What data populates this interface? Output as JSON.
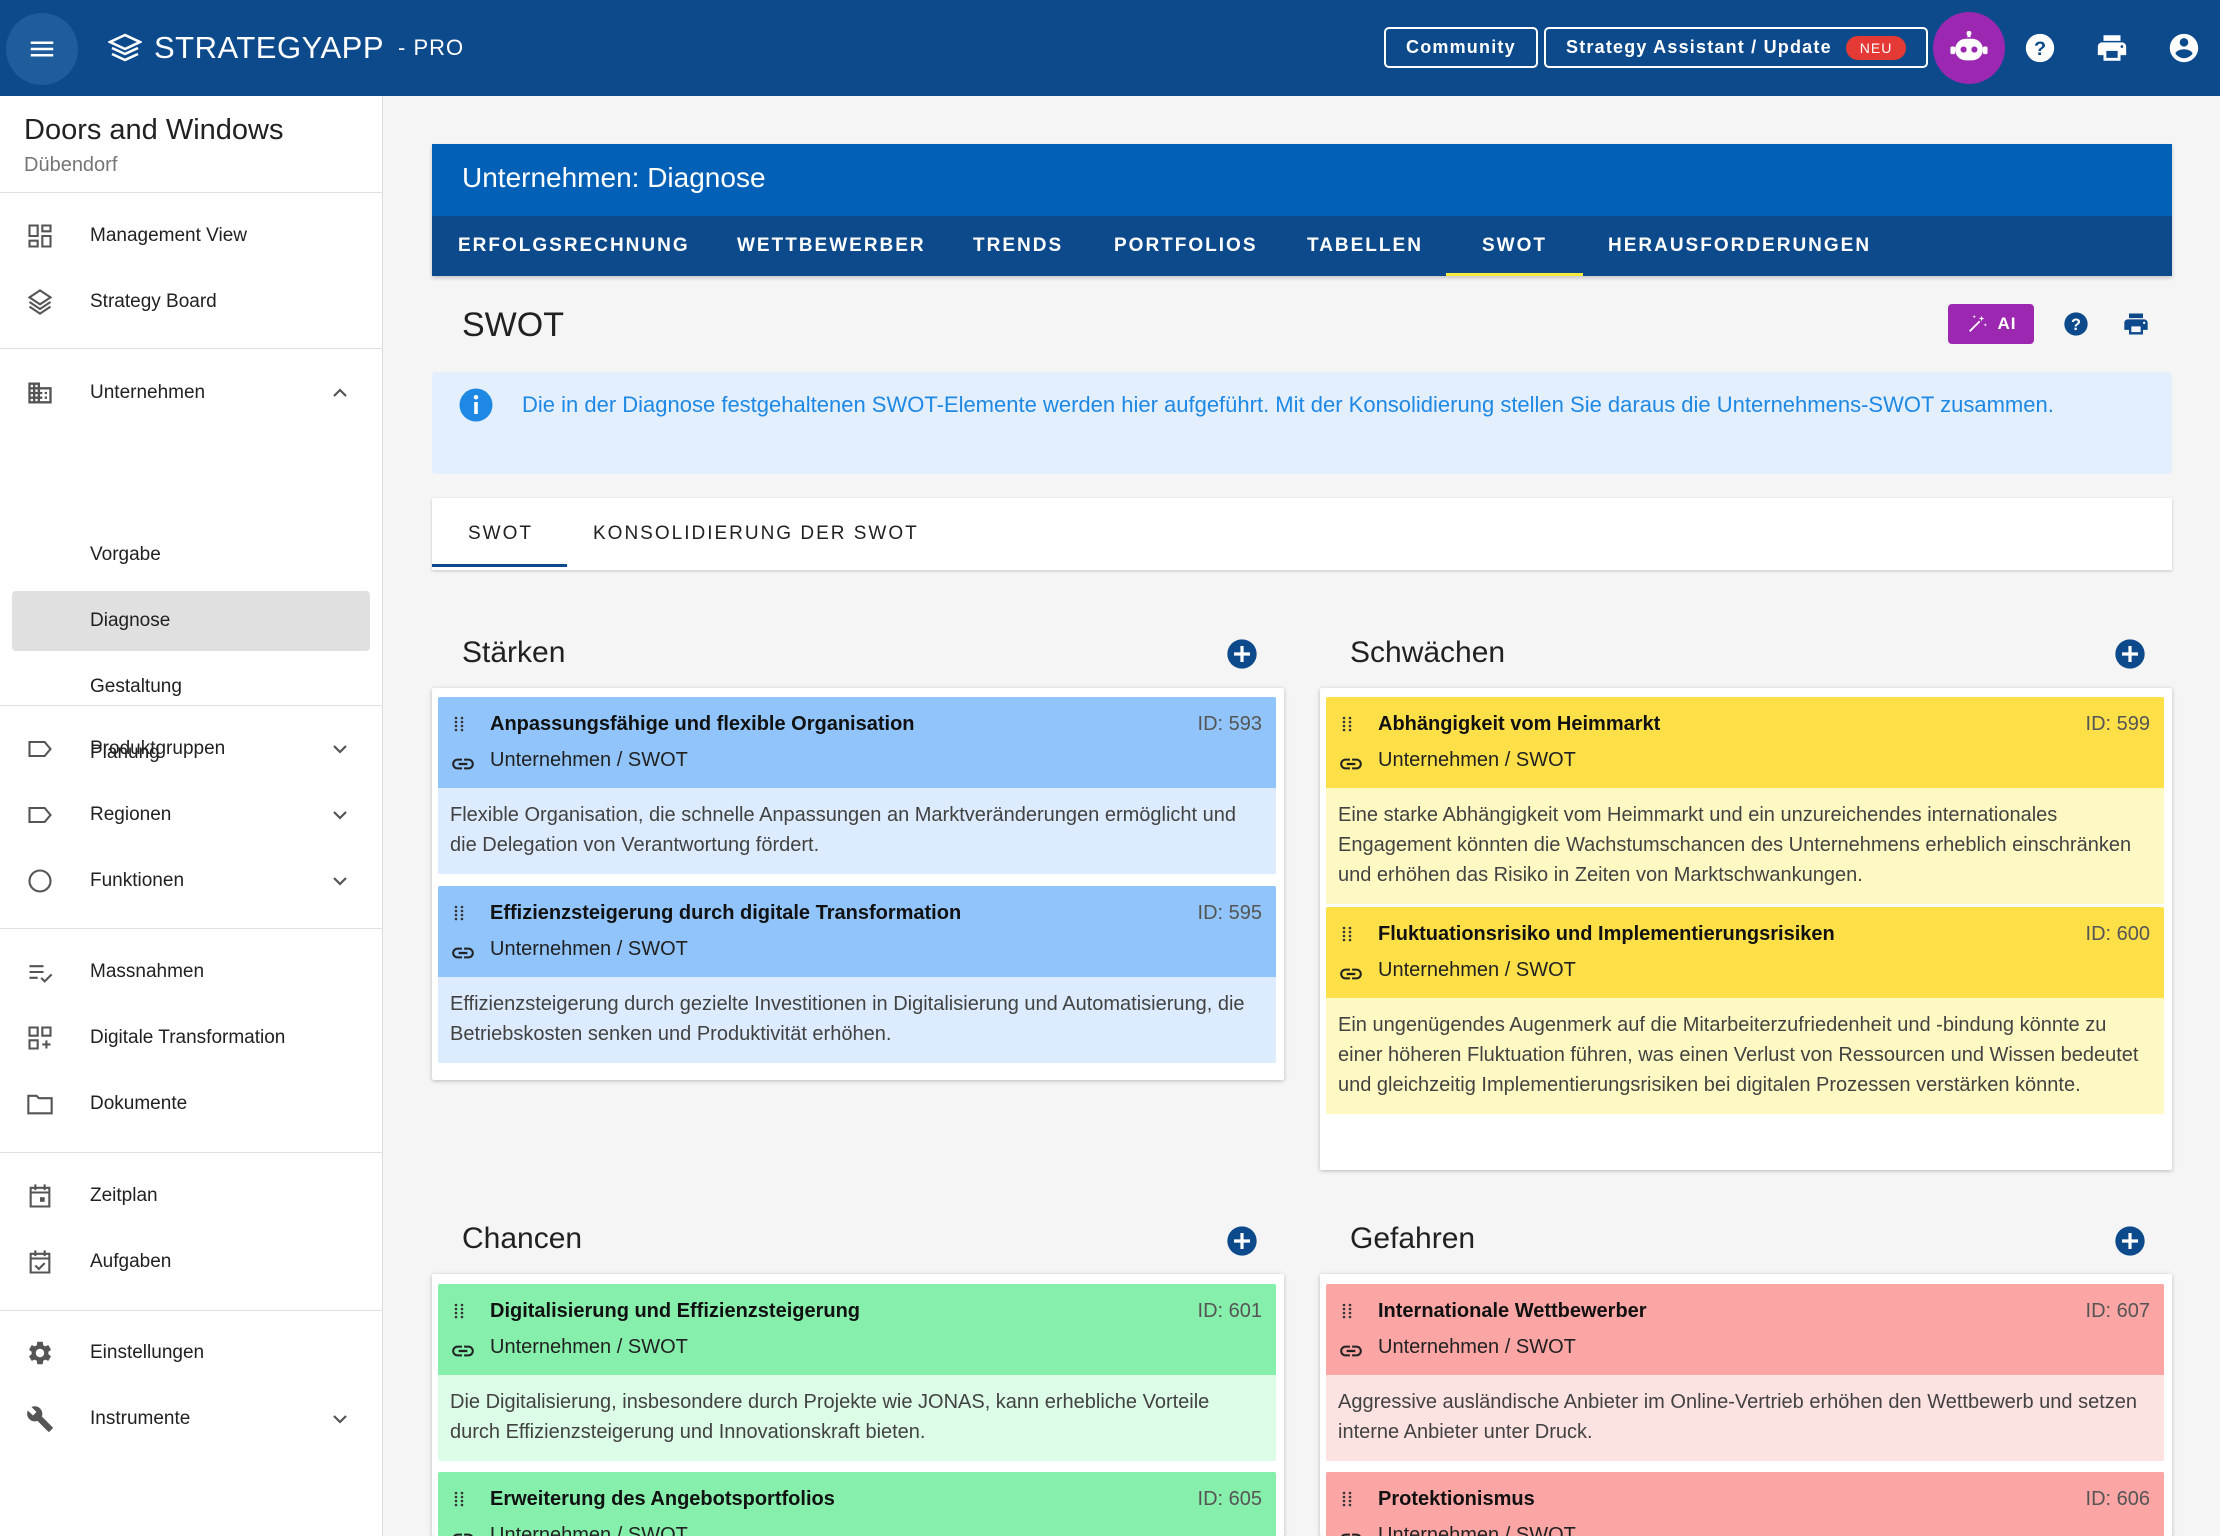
{
  "topbar": {
    "logo_text": "STRATEGYAPP",
    "logo_suffix": "- PRO",
    "community_label": "Community",
    "assistant_label": "Strategy Assistant / Update",
    "neu_badge": "NEU",
    "icons": [
      "menu-icon",
      "robot-icon",
      "help-icon",
      "print-icon",
      "account-icon"
    ],
    "colors": {
      "bar": "#0d4a8c",
      "bot": "#9c27b0",
      "badge": "#e53935"
    }
  },
  "sidebar": {
    "org_name": "Doors and Windows",
    "org_city": "Dübendorf",
    "items": [
      {
        "label": "Management View",
        "icon": "dashboard-icon"
      },
      {
        "label": "Strategy Board",
        "icon": "layers-icon"
      },
      {
        "label": "Unternehmen",
        "icon": "building-icon"
      },
      {
        "label": "Vorgabe"
      },
      {
        "label": "Diagnose",
        "active": true
      },
      {
        "label": "Gestaltung"
      },
      {
        "label": "Planung"
      },
      {
        "label": "Produktgruppen",
        "icon": "label-icon"
      },
      {
        "label": "Regionen",
        "icon": "label-icon"
      },
      {
        "label": "Funktionen",
        "icon": "circle-icon"
      },
      {
        "label": "Massnahmen",
        "icon": "checklist-icon"
      },
      {
        "label": "Digitale Transformation",
        "icon": "grid-add-icon"
      },
      {
        "label": "Dokumente",
        "icon": "folder-icon"
      },
      {
        "label": "Zeitplan",
        "icon": "calendar-icon"
      },
      {
        "label": "Aufgaben",
        "icon": "calendar-check-icon"
      },
      {
        "label": "Einstellungen",
        "icon": "gear-icon"
      },
      {
        "label": "Instrumente",
        "icon": "wrench-icon"
      }
    ]
  },
  "main": {
    "title": "Unternehmen: Diagnose",
    "tabs": [
      "ERFOLGSRECHNUNG",
      "WETTBEWERBER",
      "TRENDS",
      "PORTFOLIOS",
      "TABELLEN",
      "SWOT",
      "HERAUSFORDERUNGEN"
    ],
    "active_tab": "SWOT"
  },
  "page": {
    "title": "SWOT",
    "ai_label": "AI",
    "info_text": "Die in der Diagnose festgehaltenen SWOT-Elemente werden hier aufgeführt. Mit der Konsolidierung stellen Sie daraus die Unternehmens-SWOT zusammen.",
    "subtabs": [
      "SWOT",
      "KONSOLIDIERUNG DER SWOT"
    ],
    "active_subtab": "SWOT"
  },
  "swot": {
    "strengths": {
      "title": "Stärken",
      "colors": {
        "head": "#90c4fb",
        "body": "#dcebfd"
      },
      "items": [
        {
          "title": "Anpassungsfähige und flexible Organisation",
          "id": "ID: 593",
          "path": "Unternehmen / SWOT",
          "text": "Flexible Organisation, die schnelle Anpassungen an Marktveränderungen ermöglicht und die Delegation von Verantwortung fördert."
        },
        {
          "title": "Effizienzsteigerung durch digitale Transformation",
          "id": "ID: 595",
          "path": "Unternehmen / SWOT",
          "text": "Effizienzsteigerung durch gezielte Investitionen in Digitalisierung und Automatisierung, die Betriebskosten senken und Produktivität erhöhen."
        }
      ]
    },
    "weaknesses": {
      "title": "Schwächen",
      "colors": {
        "head": "#fde047",
        "body": "#fef9c3"
      },
      "items": [
        {
          "title": "Abhängigkeit vom Heimmarkt",
          "id": "ID: 599",
          "path": "Unternehmen / SWOT",
          "text": "Eine starke Abhängigkeit vom Heimmarkt und ein unzureichendes internationales Engagement könnten die Wachstumschancen des Unternehmens erheblich einschränken und erhöhen das Risiko in Zeiten von Marktschwankungen."
        },
        {
          "title": "Fluktuationsrisiko und Implementierungsrisiken",
          "id": "ID: 600",
          "path": "Unternehmen / SWOT",
          "text": "Ein ungenügendes Augenmerk auf die Mitarbeiterzufriedenheit und -bindung könnte zu einer höheren Fluktuation führen, was einen Verlust von Ressourcen und Wissen bedeutet und gleichzeitig Implementierungsrisiken bei digitalen Prozessen verstärken könnte."
        }
      ]
    },
    "opportunities": {
      "title": "Chancen",
      "colors": {
        "head": "#86efac",
        "body": "#dcfce7"
      },
      "items": [
        {
          "title": "Digitalisierung und Effizienzsteigerung",
          "id": "ID: 601",
          "path": "Unternehmen / SWOT",
          "text": "Die Digitalisierung, insbesondere durch Projekte wie JONAS, kann erhebliche Vorteile durch Effizienzsteigerung und Innovationskraft bieten."
        },
        {
          "title": "Erweiterung des Angebotsportfolios",
          "id": "ID: 605",
          "path": "Unternehmen / SWOT",
          "text": ""
        }
      ]
    },
    "threats": {
      "title": "Gefahren",
      "colors": {
        "head": "#fca5a5",
        "body": "#fde2e2"
      },
      "items": [
        {
          "title": "Internationale Wettbewerber",
          "id": "ID: 607",
          "path": "Unternehmen / SWOT",
          "text": "Aggressive ausländische Anbieter im Online-Vertrieb erhöhen den Wettbewerb und setzen interne Anbieter unter Druck."
        },
        {
          "title": "Protektionismus",
          "id": "ID: 606",
          "path": "Unternehmen / SWOT",
          "text": ""
        }
      ]
    }
  }
}
